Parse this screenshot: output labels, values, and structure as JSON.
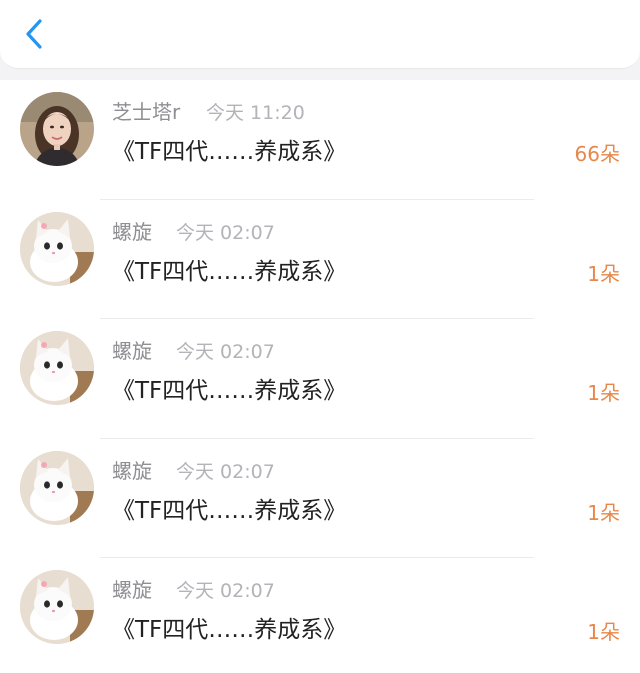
{
  "header": {
    "back_icon": "chevron-left-icon",
    "accent": "#2196f3"
  },
  "colors": {
    "count": "#e8874a",
    "name": "#8e8e93",
    "time": "#b3b3b8",
    "title": "#222222"
  },
  "items": [
    {
      "name": "芝士塔r",
      "time": "今天 11:20",
      "title": "《TF四代……养成系》",
      "count": "66朵",
      "avatar": "woman-photo"
    },
    {
      "name": "螺旋",
      "time": "今天 02:07",
      "title": "《TF四代……养成系》",
      "count": "1朵",
      "avatar": "white-kitten"
    },
    {
      "name": "螺旋",
      "time": "今天 02:07",
      "title": "《TF四代……养成系》",
      "count": "1朵",
      "avatar": "white-kitten"
    },
    {
      "name": "螺旋",
      "time": "今天 02:07",
      "title": "《TF四代……养成系》",
      "count": "1朵",
      "avatar": "white-kitten"
    },
    {
      "name": "螺旋",
      "time": "今天 02:07",
      "title": "《TF四代……养成系》",
      "count": "1朵",
      "avatar": "white-kitten"
    }
  ]
}
